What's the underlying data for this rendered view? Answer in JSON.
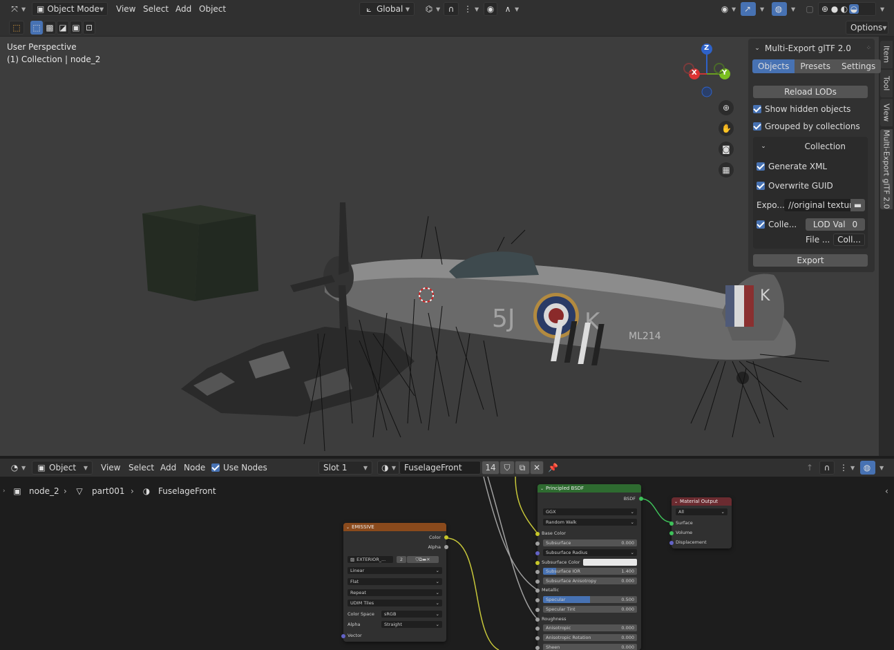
{
  "viewport_header": {
    "mode": "Object Mode",
    "menus": [
      "View",
      "Select",
      "Add",
      "Object"
    ],
    "transform_orientation": "Global",
    "options_label": "Options"
  },
  "viewport": {
    "perspective_label": "User Perspective",
    "collection_label": "(1) Collection | node_2"
  },
  "gizmo": {
    "z": "Z",
    "x": "X",
    "y": "Y"
  },
  "side_tabs": [
    "Item",
    "Tool",
    "View",
    "Multi-Export glTF 2.0"
  ],
  "npanel": {
    "title": "Multi-Export glTF 2.0",
    "tabs": [
      "Objects",
      "Presets",
      "Settings"
    ],
    "reload_lods": "Reload LODs",
    "show_hidden": "Show hidden objects",
    "grouped": "Grouped by collections",
    "collection_header": "Collection",
    "generate_xml": "Generate XML",
    "overwrite_guid": "Overwrite GUID",
    "export_label": "Expo...",
    "export_path": "//original texture\\",
    "colle_label": "Colle...",
    "lod_val": "LOD Val",
    "lod_num": "0",
    "file_label": "File ...",
    "file_value": "Coll...",
    "export_button": "Export"
  },
  "node_header": {
    "editor": "Object",
    "menus": [
      "View",
      "Select",
      "Add",
      "Node"
    ],
    "use_nodes": "Use Nodes",
    "slot": "Slot 1",
    "material": "FuselageFront",
    "users": "14"
  },
  "breadcrumb": {
    "object": "node_2",
    "mesh": "part001",
    "material": "FuselageFront"
  },
  "nodes": {
    "emissive": {
      "title": "EMISSIVE",
      "out_color": "Color",
      "out_alpha": "Alpha",
      "image": "EXTERIOR_...",
      "image_users": "2",
      "interp": "Linear",
      "proj": "Flat",
      "ext": "Repeat",
      "source": "UDIM Tiles",
      "cs_label": "Color Space",
      "cs_value": "sRGB",
      "alpha_label": "Alpha",
      "alpha_value": "Straight",
      "vector": "Vector"
    },
    "bsdf": {
      "title": "Principled BSDF",
      "out": "BSDF",
      "dist": "GGX",
      "sss": "Random Walk",
      "base_color": "Base Color",
      "subsurface": "Subsurface",
      "subsurface_v": "0.000",
      "subsurface_radius": "Subsurface Radius",
      "subsurface_color": "Subsurface Color",
      "subsurface_ior": "Subsurface IOR",
      "subsurface_ior_v": "1.400",
      "subsurface_aniso": "Subsurface Anisotropy",
      "subsurface_aniso_v": "0.000",
      "metallic": "Metallic",
      "specular": "Specular",
      "specular_v": "0.500",
      "specular_tint": "Specular Tint",
      "specular_tint_v": "0.000",
      "roughness": "Roughness",
      "anisotropic": "Anisotropic",
      "anisotropic_v": "0.000",
      "aniso_rot": "Anisotropic Rotation",
      "aniso_rot_v": "0.000",
      "sheen": "Sheen",
      "sheen_v": "0.000"
    },
    "output": {
      "title": "Material Output",
      "target": "All",
      "surface": "Surface",
      "volume": "Volume",
      "displacement": "Displacement"
    }
  },
  "colors": {
    "accent": "#4772b3",
    "emissive_header": "#8a4a1c",
    "bsdf_header": "#2e6b30",
    "output_header": "#6b2b30"
  }
}
